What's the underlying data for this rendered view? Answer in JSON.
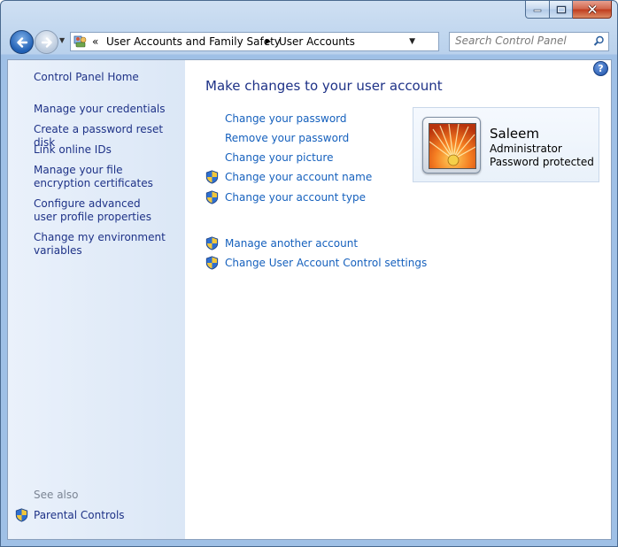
{
  "window": {
    "controls": {
      "minimize_icon": "minimize-icon",
      "maximize_icon": "maximize-icon",
      "close_icon": "close-icon"
    }
  },
  "nav": {
    "breadcrumb_overflow": "«",
    "breadcrumb": [
      "User Accounts and Family Safety",
      "User Accounts"
    ],
    "search_placeholder": "Search Control Panel"
  },
  "sidebar": {
    "home": "Control Panel Home",
    "links": [
      "Manage your credentials",
      "Create a password reset disk",
      "Link online IDs",
      "Manage your file encryption certificates",
      "Configure advanced user profile properties",
      "Change my environment variables"
    ],
    "see_also_label": "See also",
    "see_also_links": [
      "Parental Controls"
    ]
  },
  "main": {
    "heading": "Make changes to your user account",
    "help": "?",
    "tasks": [
      {
        "label": "Change your password",
        "shield": false
      },
      {
        "label": "Remove your password",
        "shield": false
      },
      {
        "label": "Change your picture",
        "shield": false
      },
      {
        "label": "Change your account name",
        "shield": true
      },
      {
        "label": "Change your account type",
        "shield": true
      }
    ],
    "other_tasks": [
      {
        "label": "Manage another account",
        "shield": true
      },
      {
        "label": "Change User Account Control settings",
        "shield": true
      }
    ]
  },
  "account": {
    "name": "Saleem",
    "type": "Administrator",
    "status": "Password protected"
  },
  "colors": {
    "link": "#1560bd",
    "heading": "#1e3287",
    "sidebar_link": "#1e3287",
    "see_also": "#7b8594"
  }
}
